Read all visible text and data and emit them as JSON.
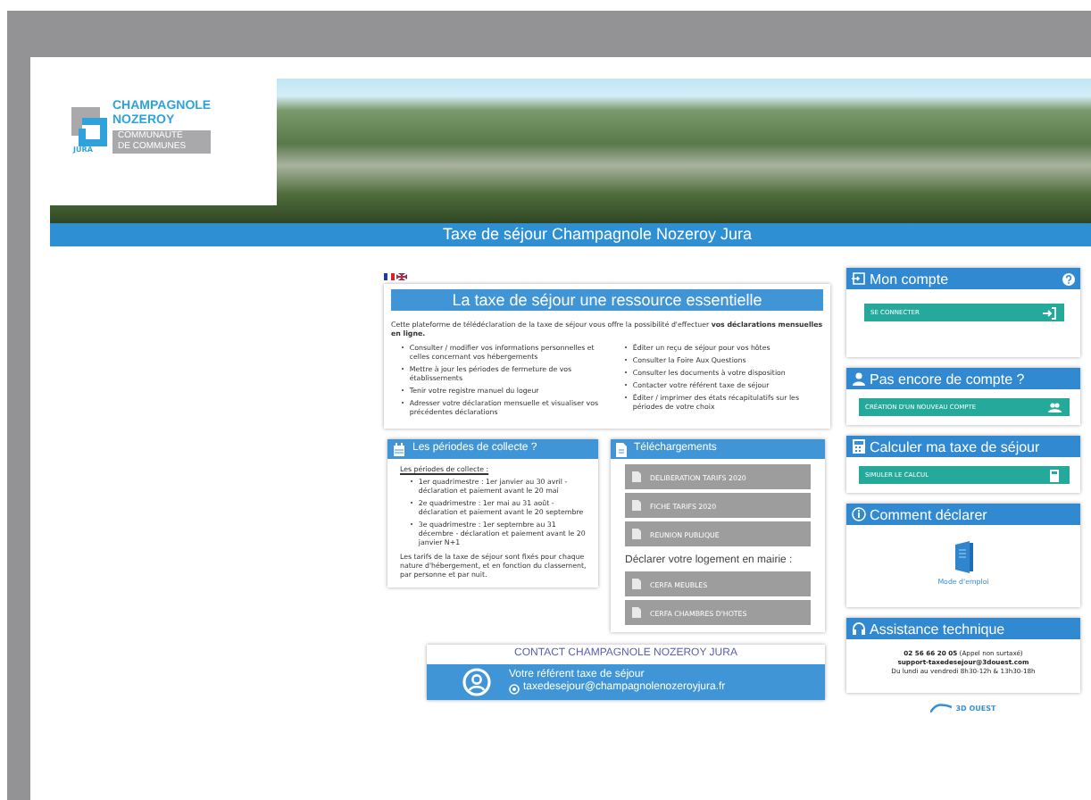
{
  "logo": {
    "name_line_1": "CHAMPAGNOLE",
    "name_line_2": "NOZEROY",
    "badge": "JURA",
    "subtitle_line_1": "COMMUNAUTÉ",
    "subtitle_line_2": "DE COMMUNES"
  },
  "title_bar": "Taxe de séjour Champagnole Nozeroy Jura",
  "intro_card": {
    "title": "La taxe de séjour une ressource essentielle",
    "text": "Cette plateforme de télédéclaration de la taxe de séjour vous offre la possibilité d'effectuer **vos déclarations mensuelles en ligne.**",
    "left_items": [
      "Consulter / modifier vos informations personnelles et celles concernant vos hébergements",
      "Mettre à jour les périodes de fermeture de vos établissements",
      "Tenir votre registre manuel du logeur",
      "Adresser votre déclaration mensuelle et visualiser vos précédentes déclarations"
    ],
    "right_items": [
      "Éditer un reçu de séjour pour vos hôtes",
      "Consulter la Foire Aux Questions",
      "Consulter les documents à votre disposition",
      "Contacter votre référent taxe de séjour",
      "Éditer / imprimer des états récapitulatifs sur les périodes de votre choix"
    ]
  },
  "periods_card": {
    "title": "Les périodes de collecte ?",
    "heading": "Les périodes de collecte :",
    "items": [
      "1er quadrimestre : 1er janvier au 30 avril - déclaration et paiement avant le 20 mai",
      "2e quadrimestre : 1er mai au 31 août - déclaration et paiement avant le 20 septembre",
      "3e quadrimestre : 1er septembre au 31 décembre - déclaration et paiement avant le 20 janvier N+1"
    ],
    "note": "Les tarifs de la taxe de séjour sont fixés pour chaque nature d'hébergement, et en fonction du classement, par personne et par nuit."
  },
  "downloads_card": {
    "title": "Téléchargements",
    "files": [
      "DELIBERATION TARIFS 2020",
      "FICHE TARIFS 2020",
      "REUNION PUBLIQUE"
    ],
    "declare_heading": "Déclarer votre logement en mairie :",
    "forms": [
      "CERFA MEUBLES",
      "CERFA CHAMBRES D'HOTES"
    ]
  },
  "contact_card": {
    "title": "CONTACT CHAMPAGNOLE NOZEROY JURA",
    "role": "Votre référent taxe de séjour",
    "email": "taxedesejour@champagnolenozeroyjura.fr"
  },
  "sidebar": [
    {
      "kind": "button",
      "title": "Mon compte",
      "help": true,
      "button": "SE CONNECTER"
    },
    {
      "kind": "button",
      "title": "Pas encore de compte ?",
      "help": false,
      "button": "CRÉATION D'UN NOUVEAU COMPTE"
    },
    {
      "kind": "button",
      "title": "Calculer ma taxe de séjour",
      "help": false,
      "button": "SIMULER LE CALCUL"
    },
    {
      "kind": "guide",
      "title": "Comment déclarer",
      "link": "Mode d'emploi"
    },
    {
      "kind": "support",
      "title": "Assistance technique",
      "lines": [
        "**02 56 66 20 05** (Appel non surtaxé)",
        "support-taxedesejour@3douest.com",
        "Du lundi au vendredi 8h30-12h & 13h30-18h"
      ]
    }
  ],
  "footer_logo": "3D OUEST"
}
